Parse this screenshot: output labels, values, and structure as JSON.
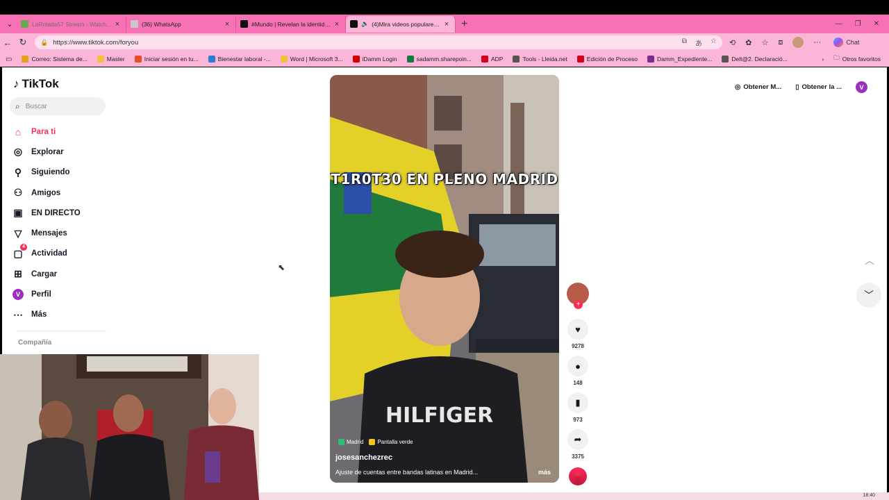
{
  "browser": {
    "tabs": [
      {
        "title": "LaRolada57 Stream - Watch Live on",
        "color": "#6aa84f",
        "active": false
      },
      {
        "title": "(36) WhatsApp",
        "color": "#c8c8c8",
        "active": false
      },
      {
        "title": "#Mundo | Revelan la identidad de",
        "color": "#111111",
        "active": false
      },
      {
        "title": "(4)Mira videos populares selec",
        "color": "#111111",
        "active": true
      }
    ],
    "url": "https://www.tiktok.com/foryou",
    "chat_label": "Chat",
    "bookmarks": [
      {
        "label": "Correo: Sistema de...",
        "color": "#e6a117"
      },
      {
        "label": "Master",
        "color": "#f0c040"
      },
      {
        "label": "Iniciar sesión en tu...",
        "color": "#e44d26"
      },
      {
        "label": "Bienestar laboral -...",
        "color": "#2d7dd2"
      },
      {
        "label": "Word | Microsoft 3...",
        "color": "#f0c040"
      },
      {
        "label": "iDamm Login",
        "color": "#d00000"
      },
      {
        "label": "sadamm.sharepoin...",
        "color": "#107c41"
      },
      {
        "label": "ADP",
        "color": "#d0021b"
      },
      {
        "label": "Tools - Lleida.net",
        "color": "#555555"
      },
      {
        "label": "Edición de Proceso",
        "color": "#d0021b"
      },
      {
        "label": "Damm_Expediente...",
        "color": "#7b2d8e"
      },
      {
        "label": "Delt@2. Declaració...",
        "color": "#555555"
      }
    ],
    "other_favorites": "Otros favoritos"
  },
  "tiktok": {
    "logo": "TikTok",
    "search_placeholder": "Buscar",
    "nav": [
      {
        "label": "Para ti",
        "icon": "home-icon",
        "active": true
      },
      {
        "label": "Explorar",
        "icon": "compass-icon",
        "active": false
      },
      {
        "label": "Siguiendo",
        "icon": "following-icon",
        "active": false
      },
      {
        "label": "Amigos",
        "icon": "friends-icon",
        "active": false
      },
      {
        "label": "EN DIRECTO",
        "icon": "live-icon",
        "active": false
      },
      {
        "label": "Mensajes",
        "icon": "messages-icon",
        "active": false
      },
      {
        "label": "Actividad",
        "icon": "activity-icon",
        "active": false,
        "badge": "4"
      },
      {
        "label": "Cargar",
        "icon": "upload-icon",
        "active": false
      },
      {
        "label": "Perfil",
        "icon": "profile-avatar",
        "active": false,
        "avatar_letter": "V"
      },
      {
        "label": "Más",
        "icon": "more-icon",
        "active": false
      }
    ],
    "company_label": "Compañía",
    "top_right": {
      "get_coins": "Obtener M...",
      "get_app": "Obtener la ...",
      "avatar_letter": "V"
    },
    "video": {
      "caption": "T1R0T30 EN PLENO MADRID",
      "tags": [
        {
          "label": "Madrid",
          "color": "#2fbf71"
        },
        {
          "label": "Pantalla verde",
          "color": "#f5c518"
        }
      ],
      "author": "josesanchezrec",
      "description": "Ajuste de cuentas entre bandas latinas en Madrid...",
      "more": "más"
    },
    "actions": {
      "likes": "9278",
      "comments": "148",
      "saves": "973",
      "shares": "3375"
    }
  },
  "taskbar": {
    "clock": "18:40"
  }
}
